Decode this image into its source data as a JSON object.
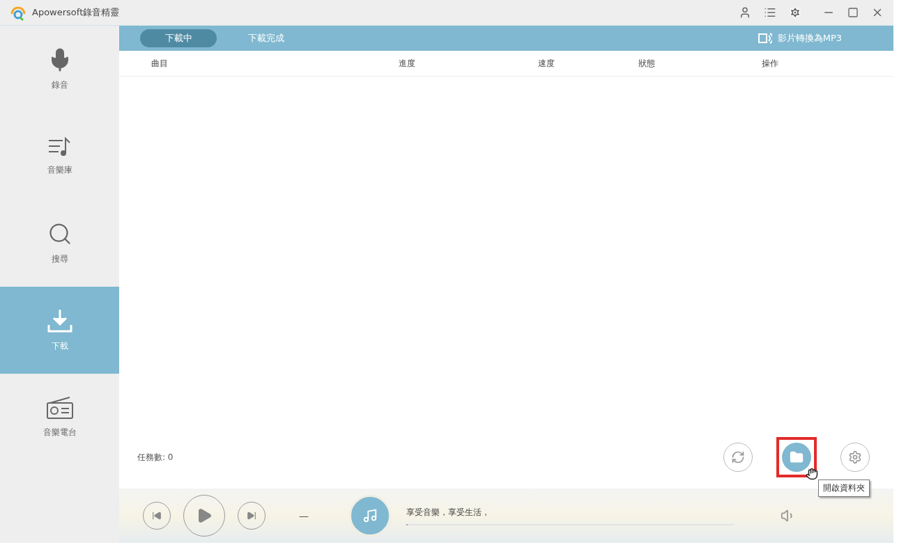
{
  "window": {
    "title": "Apowersoft錄音精靈"
  },
  "sidebar": {
    "items": [
      {
        "kind": "mic",
        "label": "錄音",
        "selected": false
      },
      {
        "kind": "library",
        "label": "音樂庫",
        "selected": false
      },
      {
        "kind": "search",
        "label": "搜尋",
        "selected": false
      },
      {
        "kind": "download",
        "label": "下載",
        "selected": true
      },
      {
        "kind": "radio",
        "label": "音樂電台",
        "selected": false
      }
    ]
  },
  "tabs": [
    {
      "label": "下載中",
      "selected": true
    },
    {
      "label": "下載完成",
      "selected": false
    }
  ],
  "convert_link": "影片轉換為MP3",
  "table": {
    "columns": [
      "曲目",
      "進度",
      "速度",
      "狀態",
      "操作"
    ]
  },
  "task_count": "任務數: 0",
  "actions": [
    {
      "kind": "refresh",
      "highlighted": false
    },
    {
      "kind": "folder",
      "highlighted": true
    },
    {
      "kind": "settings",
      "highlighted": false
    }
  ],
  "tooltip": "開啟資料夾",
  "player": {
    "separator": "—",
    "message": "享受音樂，享受生活，",
    "progress": {
      "level": 0
    }
  }
}
